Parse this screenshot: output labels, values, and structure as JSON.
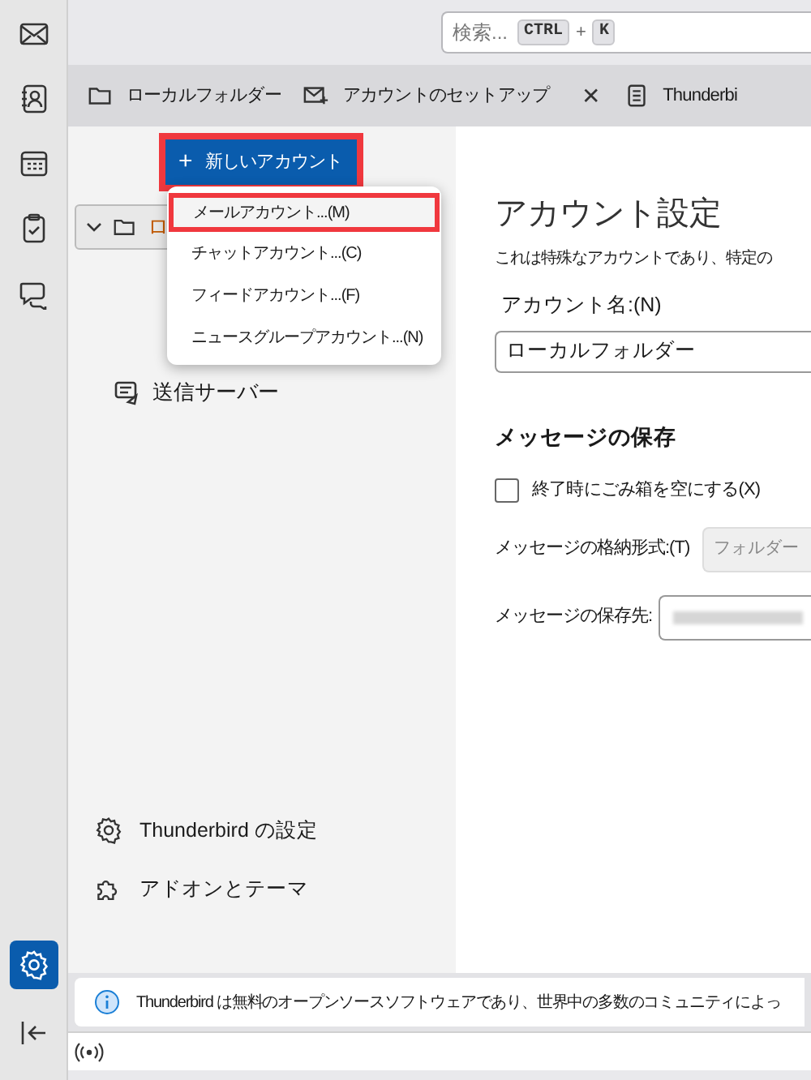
{
  "spaces": [
    {
      "kind": "mail",
      "selected": false
    },
    {
      "kind": "contacts",
      "selected": false
    },
    {
      "kind": "calendar",
      "selected": false
    },
    {
      "kind": "tasks",
      "selected": false
    },
    {
      "kind": "chat",
      "selected": false
    }
  ],
  "rail_bottom": [
    {
      "kind": "settings",
      "selected": true
    },
    {
      "kind": "collapse",
      "selected": false
    }
  ],
  "search": {
    "placeholder": "検索...",
    "keys": [
      "CTRL",
      "K"
    ],
    "joiner": "+"
  },
  "tabs": [
    {
      "kind": "folder",
      "label": "ローカルフォルダー",
      "closable": false
    },
    {
      "kind": "account",
      "label": "アカウントのセットアップ",
      "closable": true
    },
    {
      "kind": "document",
      "label": "Thunderbi",
      "closable": false
    }
  ],
  "close_glyph": "✕",
  "new_account_button": {
    "label": "新しいアカウント",
    "glyph": "+"
  },
  "menu": [
    {
      "label": "メールアカウント...(M)",
      "selected": true
    },
    {
      "label": "チャットアカウント...(C)",
      "selected": false
    },
    {
      "label": "フィードアカウント...(F)",
      "selected": false
    },
    {
      "label": "ニュースグループアカウント...(N)",
      "selected": false
    }
  ],
  "account_tree": {
    "label": "ロ",
    "expanded": true
  },
  "server_item": {
    "label": "送信サーバー"
  },
  "footer_items": [
    {
      "kind": "settings",
      "label": "Thunderbird の設定"
    },
    {
      "kind": "addons",
      "label": "アドオンとテーマ"
    }
  ],
  "settings": {
    "title": "アカウント設定",
    "description": "これは特殊なアカウントであり、特定の",
    "name_label": "アカウント名:(N)",
    "name_value": "ローカルフォルダー",
    "section": "メッセージの保存",
    "empty_trash": {
      "label": "終了時にごみ箱を空にする(X)",
      "checked": false
    },
    "format_label": "メッセージの格納形式:(T)",
    "format_value": "フォルダー",
    "location_label": "メッセージの保存先:"
  },
  "notification": "Thunderbird は無料のオープンソースソフトウェアであり、世界中の多数のコミュニティによっ"
}
